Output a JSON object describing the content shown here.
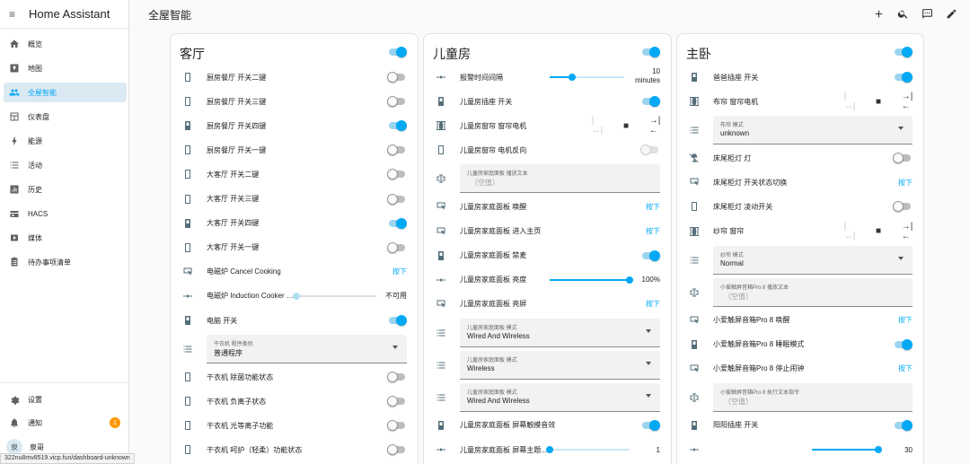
{
  "app": {
    "title": "Home Assistant"
  },
  "page": {
    "title": "全屋智能"
  },
  "sidebar": {
    "items": [
      {
        "label": "概览",
        "icon": "home-icon"
      },
      {
        "label": "地图",
        "icon": "map-icon"
      },
      {
        "label": "全屋智能",
        "icon": "people-icon",
        "active": true
      },
      {
        "label": "仪表盘",
        "icon": "dashboard-icon"
      },
      {
        "label": "能源",
        "icon": "bolt-icon"
      },
      {
        "label": "活动",
        "icon": "list-icon"
      },
      {
        "label": "历史",
        "icon": "chart-icon"
      },
      {
        "label": "HACS",
        "icon": "hacs-icon"
      },
      {
        "label": "媒体",
        "icon": "media-icon"
      },
      {
        "label": "待办事项清单",
        "icon": "clipboard-icon"
      }
    ],
    "settings_label": "设置",
    "notifications_label": "通知",
    "notifications_count": "1",
    "user_name": "泉哥",
    "user_avatar": "泉"
  },
  "status_url": "322nu8mv8519.vicp.fun/dashboard-unknown",
  "cards": [
    {
      "title": "客厅",
      "on": true,
      "rows": [
        {
          "type": "toggle",
          "label": "厨房餐厅 开关二键",
          "on": false
        },
        {
          "type": "toggle",
          "label": "厨房餐厅 开关三键",
          "on": false
        },
        {
          "type": "toggle",
          "label": "厨房餐厅 开关四键",
          "on": true
        },
        {
          "type": "toggle",
          "label": "厨房餐厅 开关一键",
          "on": false
        },
        {
          "type": "toggle",
          "label": "大客厅 开关二键",
          "on": false
        },
        {
          "type": "toggle",
          "label": "大客厅 开关三键",
          "on": false
        },
        {
          "type": "toggle",
          "label": "大客厅 开关四键",
          "on": true
        },
        {
          "type": "toggle",
          "label": "大客厅 开关一键",
          "on": false
        },
        {
          "type": "button",
          "label": "电磁炉 Cancel Cooking",
          "action": "按下"
        },
        {
          "type": "slider",
          "label": "电磁炉 Induction Cooker H...",
          "value_text": "不可用",
          "fraction": 0.0,
          "disabled": true
        },
        {
          "type": "toggle",
          "label": "电脑 开关",
          "on": true
        },
        {
          "type": "select",
          "field_label": "干衣机 程序类别",
          "value": "普通程序"
        },
        {
          "type": "toggle",
          "label": "干衣机 除菌功能状态",
          "on": false
        },
        {
          "type": "toggle",
          "label": "干衣机 负离子状态",
          "on": false
        },
        {
          "type": "toggle",
          "label": "干衣机 光等离子功能",
          "on": false
        },
        {
          "type": "toggle",
          "label": "干衣机 呵护（轻柔）功能状态",
          "on": false
        }
      ]
    },
    {
      "title": "儿童房",
      "on": true,
      "rows": [
        {
          "type": "slider",
          "label": "报警时间间隔",
          "value_text": "10",
          "unit": "minutes",
          "fraction": 0.3
        },
        {
          "type": "toggle",
          "label": "儿童房插座 开关",
          "on": true
        },
        {
          "type": "cover",
          "label": "儿童房窗帘 窗帘电机"
        },
        {
          "type": "toggle",
          "label": "儿童房窗帘 电机反向",
          "on": false,
          "disabled": true
        },
        {
          "type": "text",
          "field_label": "儿童房家庭面板 播放文本",
          "placeholder": "（空值）"
        },
        {
          "type": "button",
          "label": "儿童房家庭面板 唤醒",
          "action": "按下"
        },
        {
          "type": "button",
          "label": "儿童房家庭面板 进入主页",
          "action": "按下"
        },
        {
          "type": "toggle",
          "label": "儿童房家庭面板 禁麦",
          "on": true
        },
        {
          "type": "slider",
          "label": "儿童房家庭面板 亮度",
          "value_text": "100%",
          "fraction": 1.0
        },
        {
          "type": "button",
          "label": "儿童房家庭面板 亮屏",
          "action": "按下"
        },
        {
          "type": "select",
          "field_label": "儿童房家庭面板 模式",
          "value": "Wired And Wireless"
        },
        {
          "type": "select",
          "field_label": "儿童房家庭面板 模式",
          "value": "Wireless"
        },
        {
          "type": "select",
          "field_label": "儿童房家庭面板 模式",
          "value": "Wired And Wireless"
        },
        {
          "type": "toggle",
          "label": "儿童房家庭面板 屏幕触摸音效",
          "on": true
        },
        {
          "type": "slider",
          "label": "儿童房家庭面板 屏幕主题...",
          "value_text": "1",
          "fraction": 0.0
        }
      ]
    },
    {
      "title": "主卧",
      "on": true,
      "rows": [
        {
          "type": "toggle",
          "label": "爸爸插座 开关",
          "on": true
        },
        {
          "type": "cover",
          "label": "布帘 窗帘电机"
        },
        {
          "type": "select",
          "field_label": "布帘 模式",
          "value": "unknown"
        },
        {
          "type": "toggle",
          "label": "床尾柜灯 灯",
          "on": false
        },
        {
          "type": "button",
          "label": "床尾柜灯 开关状态切换",
          "action": "按下"
        },
        {
          "type": "toggle",
          "label": "床尾柜灯 凌动开关",
          "on": false
        },
        {
          "type": "cover",
          "label": "纱帘 窗帘"
        },
        {
          "type": "select",
          "field_label": "纱帘 模式",
          "value": "Normal"
        },
        {
          "type": "text",
          "field_label": "小爱触屏音箱Pro 8 播放文本",
          "placeholder": "（空值）"
        },
        {
          "type": "button",
          "label": "小爱触屏音箱Pro 8 唤醒",
          "action": "按下"
        },
        {
          "type": "toggle",
          "label": "小爱触屏音箱Pro 8 睡眠模式",
          "on": true
        },
        {
          "type": "button",
          "label": "小爱触屏音箱Pro 8 停止闹钟",
          "action": "按下"
        },
        {
          "type": "text",
          "field_label": "小爱触屏音箱Pro 8 执行文本指令",
          "placeholder": "（空值）"
        },
        {
          "type": "toggle",
          "label": "阳阳插座 开关",
          "on": true
        },
        {
          "type": "slider",
          "label": "",
          "value_text": "30",
          "fraction": 0.95
        }
      ]
    }
  ],
  "colors": {
    "accent": "#03a9f4",
    "active_bg": "#dbe9f3",
    "badge": "#ff9800"
  }
}
